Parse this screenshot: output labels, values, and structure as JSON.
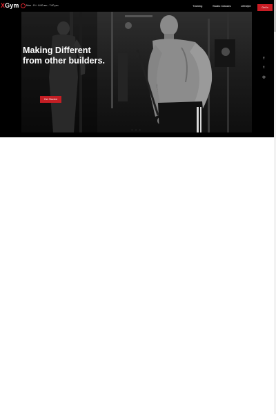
{
  "brand": {
    "logo_accent": "X",
    "logo_text": "Gym",
    "accent_color": "#e0242e"
  },
  "header": {
    "hours": "Mon - Fri : 8:00 am - 7:00 pm",
    "nav": [
      "Training",
      "Studio Classes",
      "Lifestyle"
    ],
    "cta_label": "Get In"
  },
  "hero": {
    "title": "Making Different from other builders.",
    "button_label": "Get Started",
    "slide_dots": "• • •"
  },
  "social": {
    "icons": [
      "facebook-icon",
      "twitter-icon",
      "instagram-icon"
    ],
    "glyphs": [
      "f",
      "t",
      "◎"
    ]
  }
}
